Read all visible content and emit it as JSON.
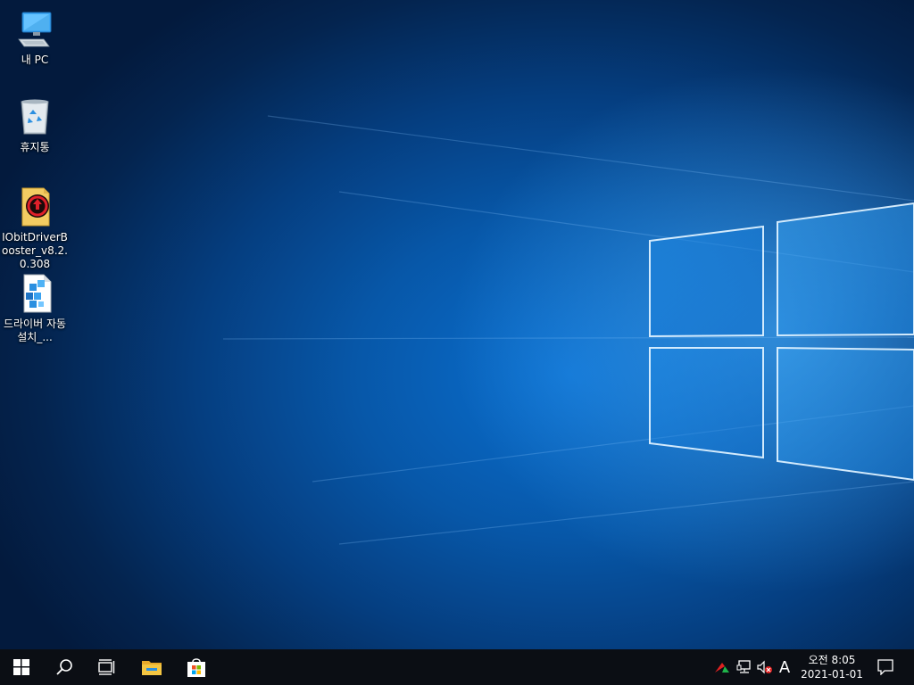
{
  "desktop": {
    "icons": [
      {
        "name": "this-pc-icon",
        "label": "내 PC"
      },
      {
        "name": "recycle-bin-icon",
        "label": "휴지통"
      },
      {
        "name": "iobit-driver-booster-icon",
        "label": "IObitDriverBooster_v8.2.0.308"
      },
      {
        "name": "driver-autoinstall-icon",
        "label": "드라이버 자동설치_..."
      }
    ]
  },
  "taskbar": {
    "start": "start-icon",
    "search": "search-icon",
    "task_view": "task-view-icon",
    "pinned": [
      "file-explorer-icon",
      "microsoft-store-icon"
    ],
    "tray": {
      "icons": [
        "network-activity-icon",
        "network-icon",
        "volume-muted-icon"
      ],
      "ime": "A",
      "time": "오전 8:05",
      "date": "2021-01-01",
      "notification": "action-center-icon"
    }
  },
  "colors": {
    "taskbar_bg": "#0b0e14",
    "wallpaper_blue": "#0a6fd0",
    "explorer_yellow": "#f4c542"
  }
}
